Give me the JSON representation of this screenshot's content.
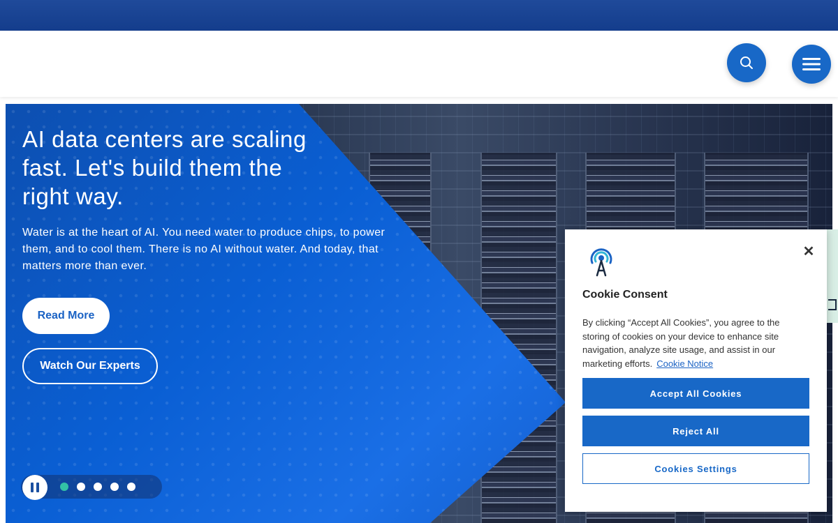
{
  "header": {
    "search_icon": "search-icon",
    "menu_icon": "hamburger-menu-icon",
    "accent_color": "#1868c7"
  },
  "hero": {
    "title": "AI data centers are scaling fast. Let's build them the right way.",
    "body": "Water is at the heart of AI. You need water to produce chips, to power them, and to cool them. There is no AI without water. And today, that matters more than ever.",
    "read_more_label": "Read More",
    "watch_label": "Watch Our Experts",
    "carousel": {
      "pause_icon": "pause-icon",
      "slide_count": 5,
      "active_slide": 1,
      "active_color": "#33c2a6"
    }
  },
  "cookie": {
    "logo_icon": "broadcast-tower-icon",
    "title": "Cookie Consent",
    "body": "By clicking “Accept All Cookies”, you agree to the storing of cookies on your device to enhance site navigation, analyze site usage, and assist in our marketing efforts.",
    "notice_link": "Cookie Notice",
    "accept_label": "Accept All Cookies",
    "reject_label": "Reject All",
    "settings_label": "Cookies Settings",
    "close_icon": "close-icon"
  }
}
